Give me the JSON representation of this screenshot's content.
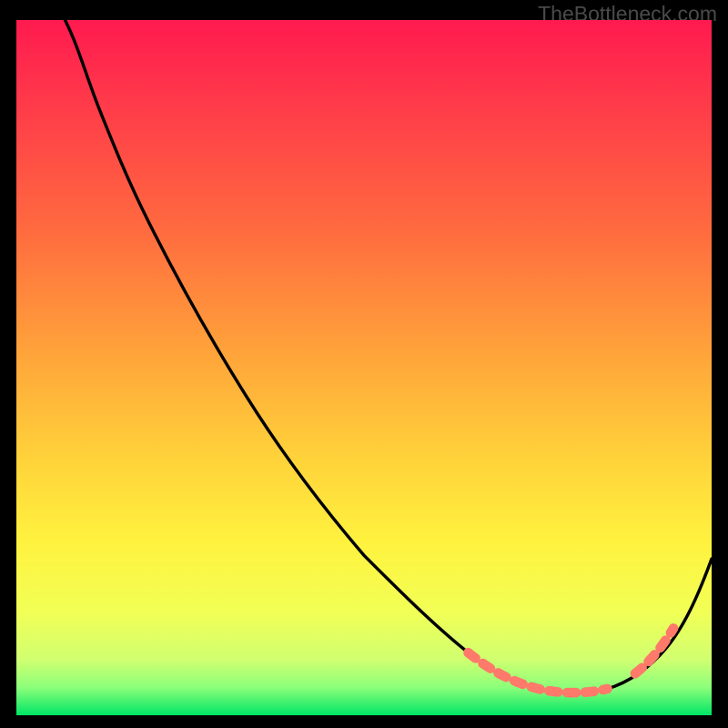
{
  "watermark": "TheBottleneck.com",
  "chart_data": {
    "type": "line",
    "title": "",
    "xlabel": "",
    "ylabel": "",
    "xlim": [
      0,
      100
    ],
    "ylim": [
      0,
      100
    ],
    "grid": false,
    "legend": false,
    "notes": "Background is a vertical heat gradient (red at top = high bottleneck, green at bottom = low). The black curve shows bottleneck % vs an implicit x-axis (component performance). Salmon dashed markers highlight the optimal region near the trough.",
    "series": [
      {
        "name": "bottleneck-curve",
        "color": "#000000",
        "x": [
          7,
          12,
          19,
          26,
          33,
          40,
          47,
          54,
          61,
          65,
          70,
          75,
          78,
          81,
          85,
          88,
          91,
          94,
          97,
          100
        ],
        "y": [
          100,
          87,
          71,
          60,
          46,
          37,
          27,
          19,
          12,
          9,
          6,
          4,
          3.3,
          3.1,
          3.8,
          5.2,
          7.5,
          11,
          16.5,
          22.5
        ]
      },
      {
        "name": "optimal-range-dashes-left",
        "color": "#ff7a6a",
        "style": "dashed",
        "x": [
          65,
          70,
          75,
          78,
          81,
          85
        ],
        "y": [
          9,
          6,
          4,
          3.3,
          3.1,
          3.8
        ]
      },
      {
        "name": "optimal-range-dashes-right",
        "color": "#ff7a6a",
        "style": "dashed",
        "x": [
          89,
          91,
          93,
          94.5
        ],
        "y": [
          6.0,
          7.5,
          10.0,
          12.5
        ]
      }
    ],
    "gradient_stops": [
      {
        "offset": 0.0,
        "color": "#ff1a4f"
      },
      {
        "offset": 0.12,
        "color": "#ff3a4a"
      },
      {
        "offset": 0.3,
        "color": "#ff6a3f"
      },
      {
        "offset": 0.48,
        "color": "#ffa43a"
      },
      {
        "offset": 0.63,
        "color": "#ffd23a"
      },
      {
        "offset": 0.75,
        "color": "#fff23e"
      },
      {
        "offset": 0.85,
        "color": "#f2ff55"
      },
      {
        "offset": 0.92,
        "color": "#d0ff70"
      },
      {
        "offset": 0.96,
        "color": "#8cff7a"
      },
      {
        "offset": 1.0,
        "color": "#00e566"
      }
    ]
  }
}
